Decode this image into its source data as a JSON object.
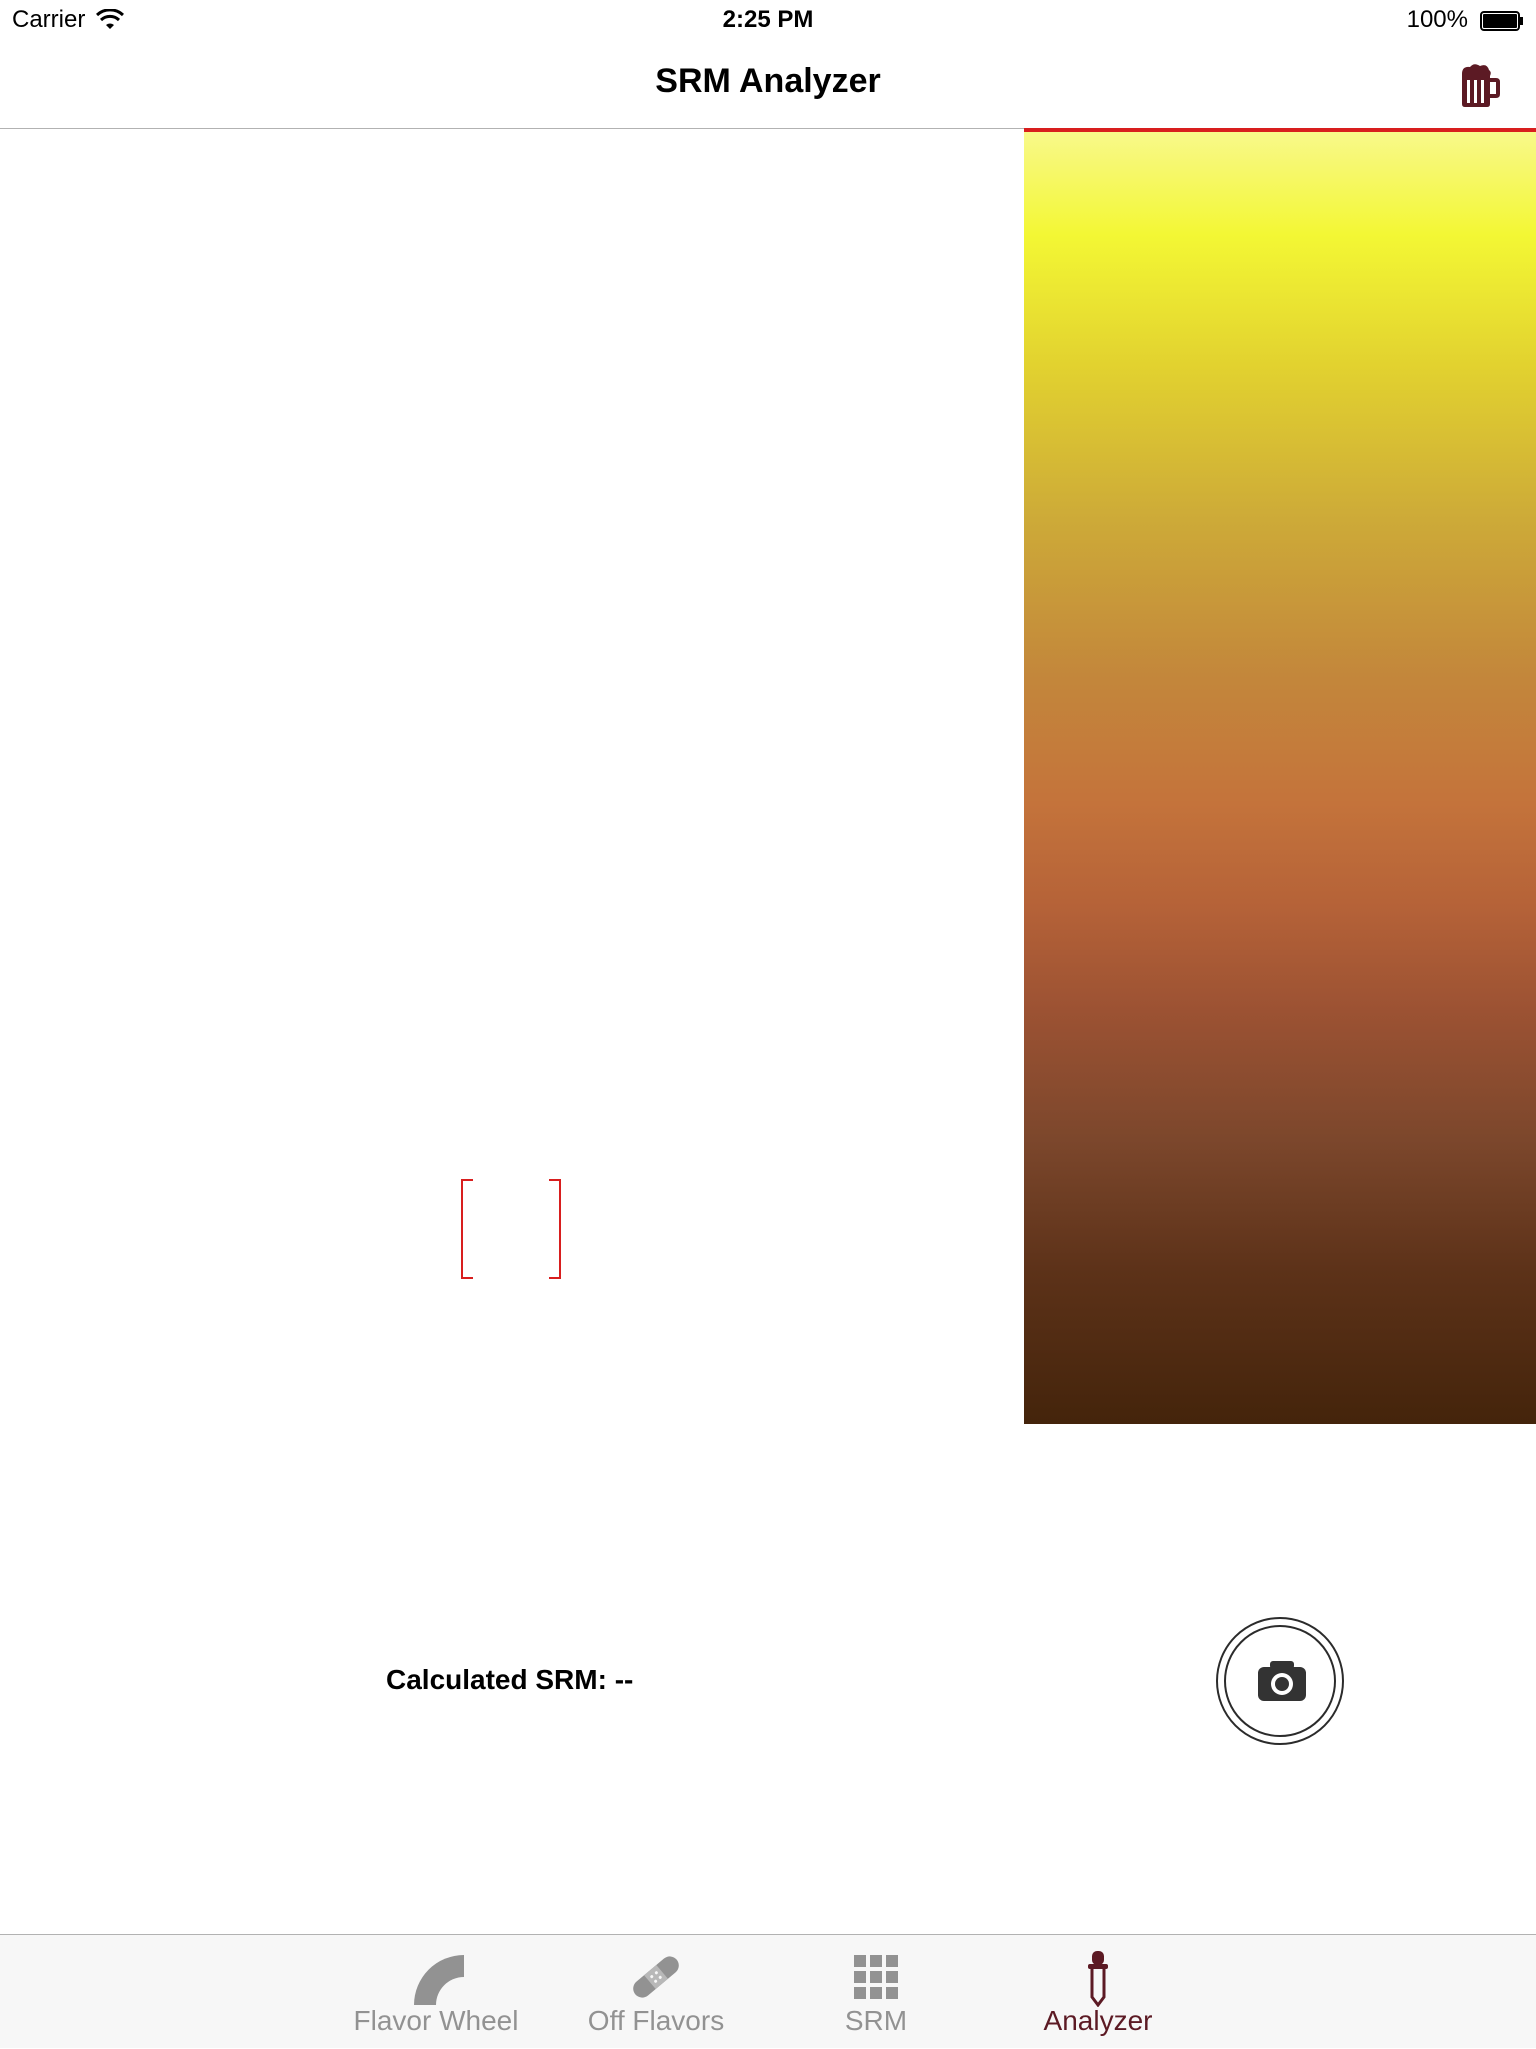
{
  "status_bar": {
    "carrier": "Carrier",
    "time": "2:25 PM",
    "battery": "100%"
  },
  "nav": {
    "title": "SRM Analyzer",
    "right_icon": "beer-mug-icon"
  },
  "srm_scale": {
    "colors": [
      "#f8f98a",
      "#f3f734",
      "#e2d22f",
      "#cdaa38",
      "#c3873b",
      "#c4733b",
      "#b56238",
      "#9c5233",
      "#7c472c",
      "#5d3219",
      "#44240b"
    ],
    "indicator_color": "#d81e1e"
  },
  "result": {
    "label": "Calculated SRM: --"
  },
  "camera_button": {
    "icon": "camera-icon"
  },
  "tabs": [
    {
      "label": "Flavor Wheel",
      "icon": "flavor-wheel-icon",
      "active": false
    },
    {
      "label": "Off Flavors",
      "icon": "bandage-icon",
      "active": false
    },
    {
      "label": "SRM",
      "icon": "grid-icon",
      "active": false
    },
    {
      "label": "Analyzer",
      "icon": "dropper-icon",
      "active": true
    }
  ],
  "colors": {
    "accent": "#5c1a24",
    "sample_frame": "#d81e1e",
    "tab_inactive": "#929292"
  }
}
